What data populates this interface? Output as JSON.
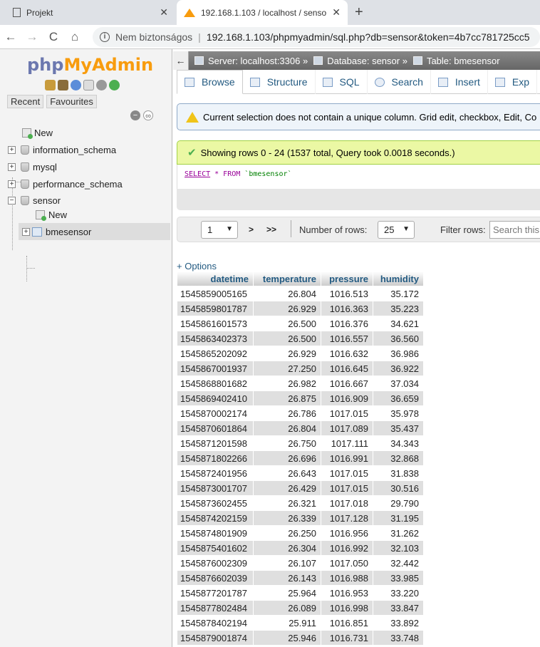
{
  "browser": {
    "tabs": [
      {
        "label": "Projekt",
        "active": false
      },
      {
        "label": "192.168.1.103 / localhost / senso",
        "active": true
      }
    ],
    "new_tab": "+",
    "nav": {
      "back": "←",
      "forward": "→",
      "reload": "C",
      "home": "⌂"
    },
    "security_label": "Nem biztonságos",
    "url": "192.168.1.103/phpmyadmin/sql.php?db=sensor&token=4b7cc781725cc5"
  },
  "sidebar": {
    "logo": {
      "php": "php",
      "my": "My",
      "admin": "Admin"
    },
    "tabs": [
      "Recent",
      "Favourites"
    ],
    "tree": {
      "new": "New",
      "databases": [
        "information_schema",
        "mysql",
        "performance_schema",
        "sensor"
      ],
      "sensor_children": {
        "new": "New",
        "table": "bmesensor"
      }
    }
  },
  "main": {
    "breadcrumb": {
      "back": "←",
      "server": "Server: localhost:3306 »",
      "database": "Database: sensor »",
      "table": "Table: bmesensor"
    },
    "tabs": [
      "Browse",
      "Structure",
      "SQL",
      "Search",
      "Insert",
      "Exp"
    ],
    "notice": "Current selection does not contain a unique column. Grid edit, checkbox, Edit, Co",
    "success": "Showing rows 0 - 24 (1537 total, Query took 0.0018 seconds.)",
    "sql": {
      "select": "SELECT",
      "rest": " * FROM ",
      "table": "`bmesensor`"
    },
    "pager": {
      "page": "1",
      "next": ">",
      "last": ">>",
      "rows_label": "Number of rows:",
      "rows": "25",
      "filter_label": "Filter rows:",
      "filter_placeholder": "Search this"
    },
    "options": "+ Options",
    "table": {
      "headers": [
        "datetime",
        "temperature",
        "pressure",
        "humidity"
      ],
      "rows": [
        [
          "1545859005165",
          "26.804",
          "1016.513",
          "35.172"
        ],
        [
          "1545859801787",
          "26.929",
          "1016.363",
          "35.223"
        ],
        [
          "1545861601573",
          "26.500",
          "1016.376",
          "34.621"
        ],
        [
          "1545863402373",
          "26.500",
          "1016.557",
          "36.560"
        ],
        [
          "1545865202092",
          "26.929",
          "1016.632",
          "36.986"
        ],
        [
          "1545867001937",
          "27.250",
          "1016.645",
          "36.922"
        ],
        [
          "1545868801682",
          "26.982",
          "1016.667",
          "37.034"
        ],
        [
          "1545869402410",
          "26.875",
          "1016.909",
          "36.659"
        ],
        [
          "1545870002174",
          "26.786",
          "1017.015",
          "35.978"
        ],
        [
          "1545870601864",
          "26.804",
          "1017.089",
          "35.437"
        ],
        [
          "1545871201598",
          "26.750",
          "1017.111",
          "34.343"
        ],
        [
          "1545871802266",
          "26.696",
          "1016.991",
          "32.868"
        ],
        [
          "1545872401956",
          "26.643",
          "1017.015",
          "31.838"
        ],
        [
          "1545873001707",
          "26.429",
          "1017.015",
          "30.516"
        ],
        [
          "1545873602455",
          "26.321",
          "1017.018",
          "29.790"
        ],
        [
          "1545874202159",
          "26.339",
          "1017.128",
          "31.195"
        ],
        [
          "1545874801909",
          "26.250",
          "1016.956",
          "31.262"
        ],
        [
          "1545875401602",
          "26.304",
          "1016.992",
          "32.103"
        ],
        [
          "1545876002309",
          "26.107",
          "1017.050",
          "32.442"
        ],
        [
          "1545876602039",
          "26.143",
          "1016.988",
          "33.985"
        ],
        [
          "1545877201787",
          "25.964",
          "1016.953",
          "33.220"
        ],
        [
          "1545877802484",
          "26.089",
          "1016.998",
          "33.847"
        ],
        [
          "1545878402194",
          "25.911",
          "1016.851",
          "33.892"
        ],
        [
          "1545879001874",
          "25.946",
          "1016.731",
          "33.748"
        ]
      ]
    }
  }
}
